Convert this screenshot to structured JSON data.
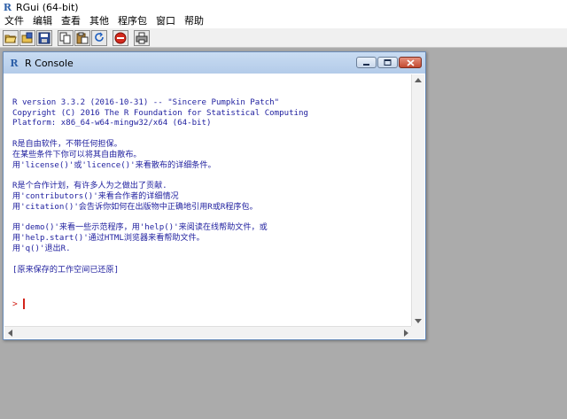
{
  "app": {
    "title": "RGui (64-bit)",
    "icon": "r-logo-icon"
  },
  "menu": [
    "文件",
    "编辑",
    "查看",
    "其他",
    "程序包",
    "窗口",
    "帮助"
  ],
  "toolbar": {
    "buttons": [
      {
        "name": "open-script-icon"
      },
      {
        "name": "load-workspace-icon"
      },
      {
        "name": "save-workspace-icon"
      },
      {
        "name": "copy-icon"
      },
      {
        "name": "paste-icon"
      },
      {
        "name": "copy-paste-icon"
      },
      {
        "name": "stop-icon"
      },
      {
        "name": "print-icon"
      }
    ]
  },
  "console": {
    "title": "R Console",
    "lines": [
      "",
      "R version 3.3.2 (2016-10-31) -- \"Sincere Pumpkin Patch\"",
      "Copyright (C) 2016 The R Foundation for Statistical Computing",
      "Platform: x86_64-w64-mingw32/x64 (64-bit)",
      "",
      "R是自由软件，不带任何担保。",
      "在某些条件下你可以将其自由散布。",
      "用'license()'或'licence()'来看散布的详细条件。",
      "",
      "R是个合作计划，有许多人为之做出了贡献.",
      "用'contributors()'来看合作者的详细情况",
      "用'citation()'会告诉你如何在出版物中正确地引用R或R程序包。",
      "",
      "用'demo()'来看一些示范程序，用'help()'来阅读在线帮助文件，或",
      "用'help.start()'通过HTML浏览器来看帮助文件。",
      "用'q()'退出R.",
      "",
      "[原来保存的工作空间已还原]"
    ],
    "prompt": ">"
  },
  "colors": {
    "console_text": "#1e1e9e",
    "prompt": "#d3241b",
    "mdi_background": "#ababab"
  }
}
